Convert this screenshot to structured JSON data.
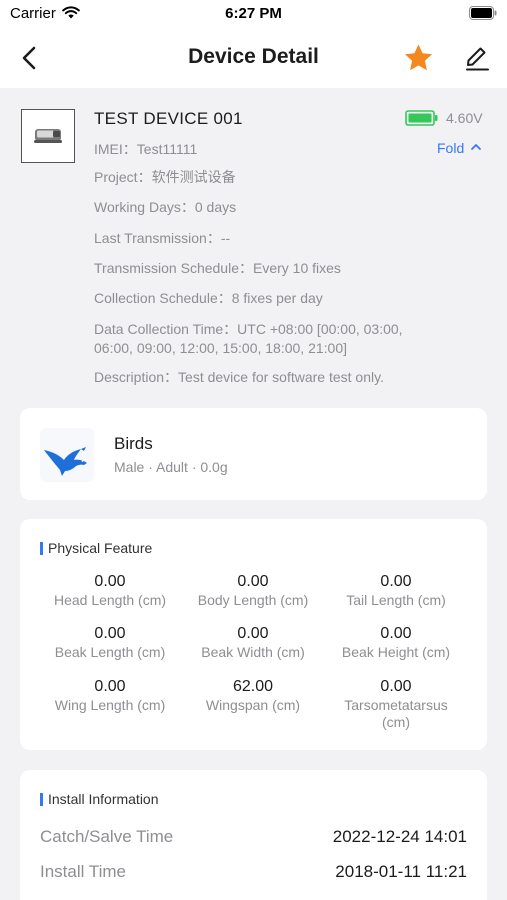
{
  "status_bar": {
    "carrier": "Carrier",
    "time": "6:27 PM"
  },
  "nav": {
    "title": "Device Detail"
  },
  "device": {
    "name": "TEST DEVICE 001",
    "voltage": "4.60V",
    "fold_label": "Fold",
    "imei": "IMEI：Test11111",
    "project": "Project：软件测试设备",
    "working_days": "Working Days：0 days",
    "last_transmission": "Last Transmission：--",
    "transmission_schedule": "Transmission Schedule：Every 10 fixes",
    "collection_schedule": "Collection Schedule：8 fixes per day",
    "data_collection_time_line1": "Data Collection Time：UTC +08:00 [00:00, 03:00,",
    "data_collection_time_line2": "06:00, 09:00, 12:00, 15:00, 18:00, 21:00]",
    "description": "Description：Test device for software test only."
  },
  "animal": {
    "name": "Birds",
    "details": "Male · Adult · 0.0g"
  },
  "physical": {
    "title": "Physical Feature",
    "items": [
      {
        "value": "0.00",
        "label": "Head Length (cm)"
      },
      {
        "value": "0.00",
        "label": "Body Length (cm)"
      },
      {
        "value": "0.00",
        "label": "Tail Length (cm)"
      },
      {
        "value": "0.00",
        "label": "Beak Length (cm)"
      },
      {
        "value": "0.00",
        "label": "Beak Width (cm)"
      },
      {
        "value": "0.00",
        "label": "Beak Height (cm)"
      },
      {
        "value": "0.00",
        "label": "Wing Length (cm)"
      },
      {
        "value": "62.00",
        "label": "Wingspan (cm)"
      },
      {
        "value": "0.00",
        "label_line1": "Tarsometatarsus",
        "label_line2": "(cm)"
      }
    ]
  },
  "install": {
    "title": "Install Information",
    "catch_label": "Catch/Salve Time",
    "catch_value": "2022-12-24 14:01",
    "install_label": "Install Time",
    "install_value": "2018-01-11 11:21"
  },
  "colors": {
    "accent": "#3478f6",
    "star": "#f5871f",
    "battery": "#34c759"
  },
  "icons": [
    "wifi-icon",
    "battery-icon",
    "back-icon",
    "star-icon",
    "edit-icon",
    "device-icon",
    "battery-level-icon",
    "chevron-up-icon",
    "bird-icon"
  ]
}
